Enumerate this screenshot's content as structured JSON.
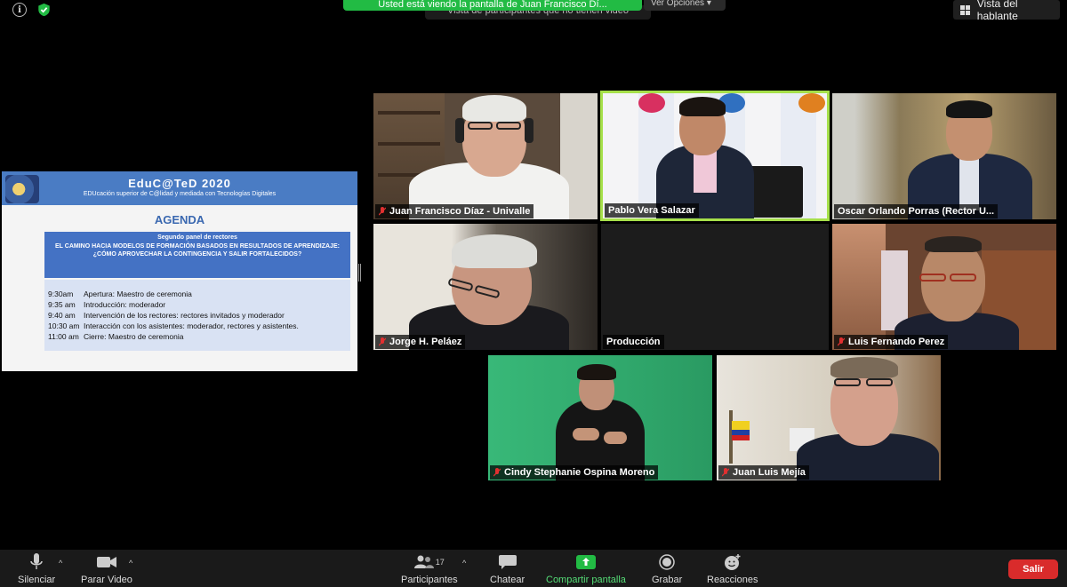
{
  "top": {
    "share_banner": "Usted está viendo la pantalla de Juan Francisco Dí...",
    "view_options": "Ver Opciones ▾",
    "tooltip": "Vista de participantes que no tienen video",
    "speaker_view": "Vista del hablante"
  },
  "slide": {
    "title": "EduC@TeD 2020",
    "subtitle": "EDUcación superior de C@lidad y mediada con Tecnologías Digitales",
    "agenda": "AGENDA",
    "panel_title": "Segundo panel de rectores",
    "panel_text": "EL CAMINO HACIA MODELOS DE FORMACIÓN BASADOS EN RESULTADOS DE APRENDIZAJE: ¿CÓMO APROVECHAR LA CONTINGENCIA Y SALIR FORTALECIDOS?",
    "items": [
      {
        "time": "9:30am",
        "text": "Apertura: Maestro de ceremonia"
      },
      {
        "time": "9:35 am",
        "text": "Introducción: moderador"
      },
      {
        "time": "9:40 am",
        "text": "Intervención de los rectores: rectores invitados y moderador"
      },
      {
        "time": "10:30 am",
        "text": "Interacción con los asistentes: moderador, rectores y asistentes."
      },
      {
        "time": "11:00 am",
        "text": "Cierre: Maestro de ceremonia"
      }
    ]
  },
  "participants": [
    {
      "name": "Juan Francisco Díaz - Univalle",
      "muted": true
    },
    {
      "name": "Pablo Vera Salazar",
      "muted": false
    },
    {
      "name": "Oscar Orlando Porras (Rector U...",
      "muted": false
    },
    {
      "name": "Jorge H. Peláez",
      "muted": true
    },
    {
      "name": "Producción",
      "muted": false
    },
    {
      "name": "Luis Fernando Perez",
      "muted": true
    },
    {
      "name": "Cindy Stephanie Ospina Moreno",
      "muted": true
    },
    {
      "name": "Juan Luis Mejía",
      "muted": true
    }
  ],
  "toolbar": {
    "mute": "Silenciar",
    "video": "Parar Video",
    "participants": "Participantes",
    "participants_count": "17",
    "chat": "Chatear",
    "share": "Compartir pantalla",
    "record": "Grabar",
    "reactions": "Reacciones",
    "leave": "Salir"
  },
  "colors": {
    "active_speaker": "#a6e04a",
    "share_green": "#22bb44",
    "leave_red": "#d92b2b"
  }
}
